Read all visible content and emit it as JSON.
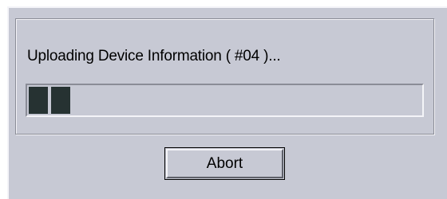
{
  "dialog": {
    "status_text": "Uploading Device Information ( #04 )...",
    "progress": {
      "filled_blocks": 2,
      "block_color": "#263232"
    },
    "abort_label": "Abort"
  },
  "colors": {
    "face": "#c7c9d4",
    "highlight": "#f4f4f8",
    "shadow": "#8a8c96"
  }
}
